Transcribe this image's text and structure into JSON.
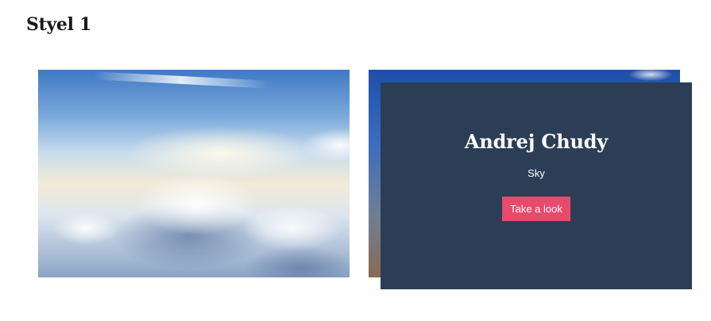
{
  "section": {
    "title": "Styel 1"
  },
  "gallery": {
    "cards": [
      {
        "image": "sky-clouds-photo"
      },
      {
        "image": "mountain-sky-photo"
      }
    ],
    "overlay": {
      "title": "Andrej Chudy",
      "subtitle": "Sky",
      "button_label": "Take a look",
      "background_color": "#2c3e55",
      "button_color": "#e84a6b"
    }
  }
}
